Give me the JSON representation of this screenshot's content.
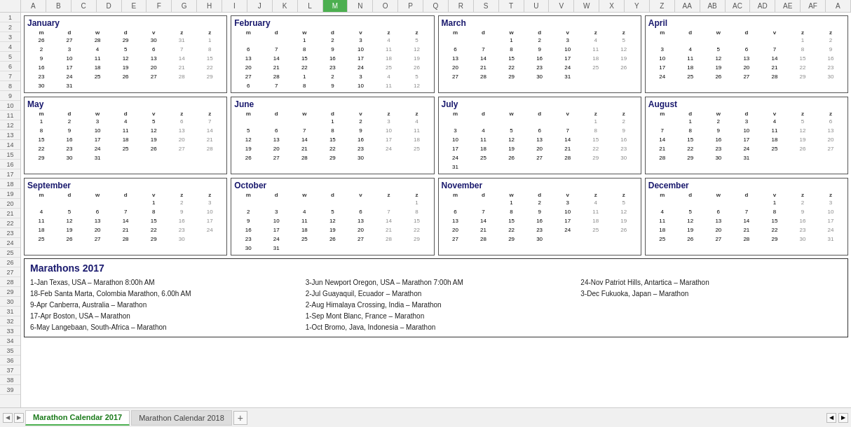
{
  "columns": [
    "A",
    "B",
    "C",
    "D",
    "E",
    "F",
    "G",
    "H",
    "I",
    "J",
    "K",
    "L",
    "M",
    "N",
    "O",
    "P",
    "Q",
    "R",
    "S",
    "T",
    "U",
    "V",
    "W",
    "X",
    "Y",
    "Z",
    "AA",
    "AB",
    "AC",
    "AD",
    "AE",
    "AF",
    "A"
  ],
  "activeColumn": "M",
  "months": [
    {
      "name": "January",
      "headers": [
        "m",
        "d",
        "w",
        "d",
        "v",
        "z",
        "z"
      ],
      "weeks": [
        [
          "26",
          "27",
          "28",
          "29",
          "30",
          "31",
          "1"
        ],
        [
          "2",
          "3",
          "4",
          "5",
          "6",
          "7",
          "8"
        ],
        [
          "9",
          "10",
          "11",
          "12",
          "13",
          "14",
          "15"
        ],
        [
          "16",
          "17",
          "18",
          "19",
          "20",
          "21",
          "22"
        ],
        [
          "23",
          "24",
          "25",
          "26",
          "27",
          "28",
          "29"
        ],
        [
          "30",
          "31",
          "",
          "",
          "",
          "",
          ""
        ]
      ]
    },
    {
      "name": "February",
      "headers": [
        "m",
        "d",
        "w",
        "d",
        "v",
        "z",
        "z"
      ],
      "weeks": [
        [
          "",
          "",
          "1",
          "2",
          "3",
          "4",
          "5"
        ],
        [
          "6",
          "7",
          "8",
          "9",
          "10",
          "11",
          "12"
        ],
        [
          "13",
          "14",
          "15",
          "16",
          "17",
          "18",
          "19"
        ],
        [
          "20",
          "21",
          "22",
          "23",
          "24",
          "25",
          "26"
        ],
        [
          "27",
          "28",
          "1",
          "2",
          "3",
          "4",
          "5"
        ],
        [
          "6",
          "7",
          "8",
          "9",
          "10",
          "11",
          "12"
        ]
      ]
    },
    {
      "name": "March",
      "headers": [
        "m",
        "d",
        "w",
        "d",
        "v",
        "z",
        "z"
      ],
      "weeks": [
        [
          "",
          "",
          "1",
          "2",
          "3",
          "4",
          "5"
        ],
        [
          "6",
          "7",
          "8",
          "9",
          "10",
          "11",
          "12"
        ],
        [
          "13",
          "14",
          "15",
          "16",
          "17",
          "18",
          "19"
        ],
        [
          "20",
          "21",
          "22",
          "23",
          "24",
          "25",
          "26"
        ],
        [
          "27",
          "28",
          "29",
          "30",
          "31",
          "",
          ""
        ]
      ]
    },
    {
      "name": "April",
      "headers": [
        "m",
        "d",
        "w",
        "d",
        "v",
        "z",
        "z"
      ],
      "weeks": [
        [
          "",
          "",
          "",
          "",
          "",
          "1",
          "2"
        ],
        [
          "3",
          "4",
          "5",
          "6",
          "7",
          "8",
          "9"
        ],
        [
          "10",
          "11",
          "12",
          "13",
          "14",
          "15",
          "16"
        ],
        [
          "17",
          "18",
          "19",
          "20",
          "21",
          "22",
          "23"
        ],
        [
          "24",
          "25",
          "26",
          "27",
          "28",
          "29",
          "30"
        ]
      ]
    },
    {
      "name": "May",
      "headers": [
        "m",
        "d",
        "w",
        "d",
        "v",
        "z",
        "z"
      ],
      "weeks": [
        [
          "1",
          "2",
          "3",
          "4",
          "5",
          "6",
          "7"
        ],
        [
          "8",
          "9",
          "10",
          "11",
          "12",
          "13",
          "14"
        ],
        [
          "15",
          "16",
          "17",
          "18",
          "19",
          "20",
          "21"
        ],
        [
          "22",
          "23",
          "24",
          "25",
          "26",
          "27",
          "28"
        ],
        [
          "29",
          "30",
          "31",
          "",
          "",
          "",
          ""
        ]
      ]
    },
    {
      "name": "June",
      "headers": [
        "m",
        "d",
        "w",
        "d",
        "v",
        "z",
        "z"
      ],
      "weeks": [
        [
          "",
          "",
          "",
          "1",
          "2",
          "3",
          "4"
        ],
        [
          "5",
          "6",
          "7",
          "8",
          "9",
          "10",
          "11"
        ],
        [
          "12",
          "13",
          "14",
          "15",
          "16",
          "17",
          "18"
        ],
        [
          "19",
          "20",
          "21",
          "22",
          "23",
          "24",
          "25"
        ],
        [
          "26",
          "27",
          "28",
          "29",
          "30",
          "",
          ""
        ]
      ]
    },
    {
      "name": "July",
      "headers": [
        "m",
        "d",
        "w",
        "d",
        "v",
        "z",
        "z"
      ],
      "weeks": [
        [
          "",
          "",
          "",
          "",
          "",
          "1",
          "2"
        ],
        [
          "3",
          "4",
          "5",
          "6",
          "7",
          "8",
          "9"
        ],
        [
          "10",
          "11",
          "12",
          "13",
          "14",
          "15",
          "16"
        ],
        [
          "17",
          "18",
          "19",
          "20",
          "21",
          "22",
          "23"
        ],
        [
          "24",
          "25",
          "26",
          "27",
          "28",
          "29",
          "30"
        ],
        [
          "31",
          "",
          "",
          "",
          "",
          "",
          ""
        ]
      ]
    },
    {
      "name": "August",
      "headers": [
        "m",
        "d",
        "w",
        "d",
        "v",
        "z",
        "z"
      ],
      "weeks": [
        [
          "",
          "1",
          "2",
          "3",
          "4",
          "5",
          "6"
        ],
        [
          "7",
          "8",
          "9",
          "10",
          "11",
          "12",
          "13"
        ],
        [
          "14",
          "15",
          "16",
          "17",
          "18",
          "19",
          "20"
        ],
        [
          "21",
          "22",
          "23",
          "24",
          "25",
          "26",
          "27"
        ],
        [
          "28",
          "29",
          "30",
          "31",
          "",
          "",
          ""
        ]
      ]
    },
    {
      "name": "September",
      "headers": [
        "m",
        "d",
        "w",
        "d",
        "v",
        "z",
        "z"
      ],
      "weeks": [
        [
          "",
          "",
          "",
          "",
          "1",
          "2",
          "3"
        ],
        [
          "4",
          "5",
          "6",
          "7",
          "8",
          "9",
          "10"
        ],
        [
          "11",
          "12",
          "13",
          "14",
          "15",
          "16",
          "17"
        ],
        [
          "18",
          "19",
          "20",
          "21",
          "22",
          "23",
          "24"
        ],
        [
          "25",
          "26",
          "27",
          "28",
          "29",
          "30",
          ""
        ]
      ]
    },
    {
      "name": "October",
      "headers": [
        "m",
        "d",
        "w",
        "d",
        "v",
        "z",
        "z"
      ],
      "weeks": [
        [
          "",
          "",
          "",
          "",
          "",
          "",
          "1"
        ],
        [
          "2",
          "3",
          "4",
          "5",
          "6",
          "7",
          "8"
        ],
        [
          "9",
          "10",
          "11",
          "12",
          "13",
          "14",
          "15"
        ],
        [
          "16",
          "17",
          "18",
          "19",
          "20",
          "21",
          "22"
        ],
        [
          "23",
          "24",
          "25",
          "26",
          "27",
          "28",
          "29"
        ],
        [
          "30",
          "31",
          "",
          "",
          "",
          "",
          ""
        ]
      ]
    },
    {
      "name": "November",
      "headers": [
        "m",
        "d",
        "w",
        "d",
        "v",
        "z",
        "z"
      ],
      "weeks": [
        [
          "",
          "",
          "1",
          "2",
          "3",
          "4",
          "5"
        ],
        [
          "6",
          "7",
          "8",
          "9",
          "10",
          "11",
          "12"
        ],
        [
          "13",
          "14",
          "15",
          "16",
          "17",
          "18",
          "19"
        ],
        [
          "20",
          "21",
          "22",
          "23",
          "24",
          "25",
          "26"
        ],
        [
          "27",
          "28",
          "29",
          "30",
          "",
          "",
          ""
        ]
      ]
    },
    {
      "name": "December",
      "headers": [
        "m",
        "d",
        "w",
        "d",
        "v",
        "z",
        "z"
      ],
      "weeks": [
        [
          "",
          "",
          "",
          "",
          "1",
          "2",
          "3"
        ],
        [
          "4",
          "5",
          "6",
          "7",
          "8",
          "9",
          "10"
        ],
        [
          "11",
          "12",
          "13",
          "14",
          "15",
          "16",
          "17"
        ],
        [
          "18",
          "19",
          "20",
          "21",
          "22",
          "23",
          "24"
        ],
        [
          "25",
          "26",
          "27",
          "28",
          "29",
          "30",
          "31"
        ]
      ]
    }
  ],
  "marathons_title": "Marathons 2017",
  "marathons": {
    "col1": [
      "1-Jan  Texas, USA – Marathon 8:00h AM",
      "18-Feb  Santa Marta, Colombia Marathon, 6.00h AM",
      "9-Apr  Canberra, Australia – Marathon",
      "17-Apr  Boston, USA – Marathon",
      "6-May  Langebaan, South-Africa – Marathon"
    ],
    "col2": [
      "3-Jun  Newport Oregon, USA – Marathon 7:00h AM",
      "2-Jul  Guayaquil, Ecuador – Marathon",
      "2-Aug  Himalaya Crossing, India – Marathon",
      "1-Sep  Mont Blanc, France – Marathon",
      "1-Oct  Bromo, Java, Indonesia – Marathon"
    ],
    "col3": [
      "24-Nov  Patriot Hills, Antartica – Marathon",
      "3-Dec  Fukuoka, Japan – Marathon"
    ]
  },
  "tabs": [
    {
      "label": "Marathon Calendar 2017",
      "active": true
    },
    {
      "label": "Marathon Calendar 2018",
      "active": false
    }
  ],
  "row_numbers": [
    "1",
    "2",
    "3",
    "4",
    "5",
    "6",
    "7",
    "8",
    "9",
    "10",
    "11",
    "12",
    "13",
    "14",
    "15",
    "16",
    "17",
    "18",
    "19",
    "20",
    "21",
    "22",
    "23",
    "24",
    "25",
    "26",
    "27",
    "28",
    "29",
    "30",
    "31",
    "32",
    "33",
    "34",
    "35",
    "36",
    "37",
    "38",
    "39"
  ]
}
